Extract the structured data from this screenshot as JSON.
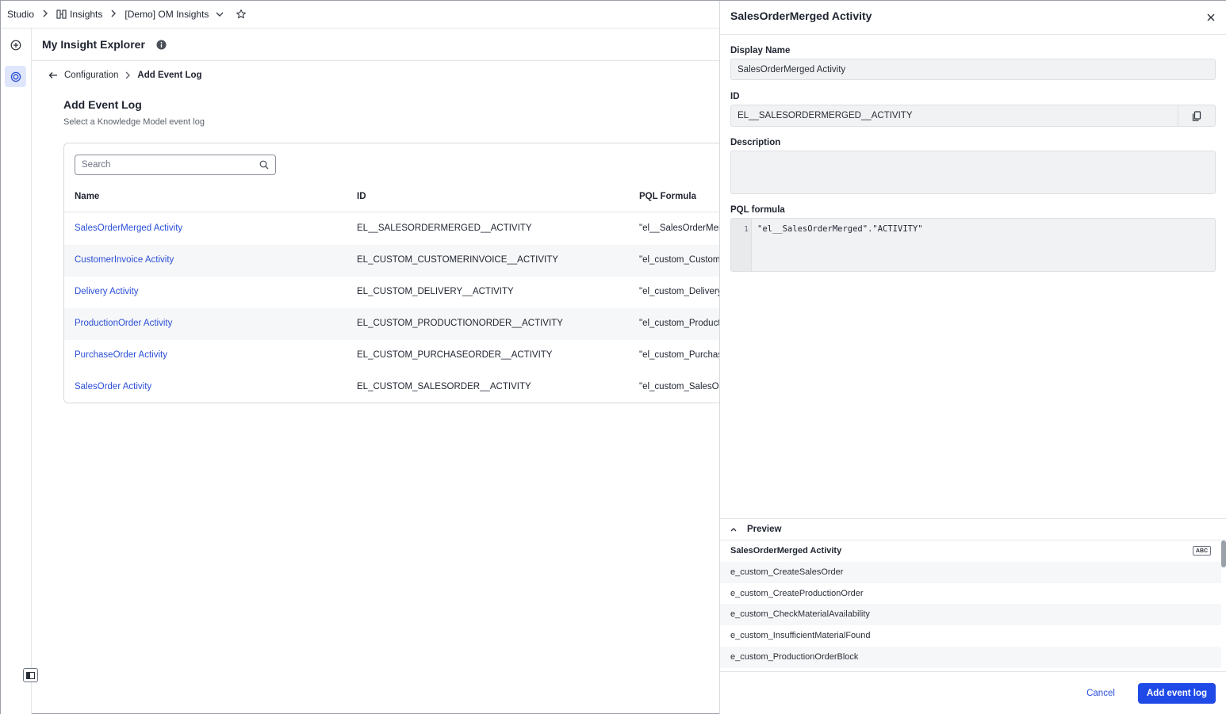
{
  "topbar": {
    "crumbs": [
      "Studio",
      "Insights",
      "[Demo] OM Insights"
    ]
  },
  "header": {
    "title": "My Insight Explorer"
  },
  "breadcrumb": {
    "parent": "Configuration",
    "current": "Add Event Log"
  },
  "section": {
    "title": "Add Event Log",
    "subtitle": "Select a Knowledge Model event log"
  },
  "search": {
    "placeholder": "Search"
  },
  "table": {
    "columns": [
      "Name",
      "ID",
      "PQL Formula"
    ],
    "rows": [
      {
        "name": "SalesOrderMerged Activity",
        "id": "EL__SALESORDERMERGED__ACTIVITY",
        "pql": "\"el__SalesOrderMer"
      },
      {
        "name": "CustomerInvoice Activity",
        "id": "EL_CUSTOM_CUSTOMERINVOICE__ACTIVITY",
        "pql": "\"el_custom_Custom"
      },
      {
        "name": "Delivery Activity",
        "id": "EL_CUSTOM_DELIVERY__ACTIVITY",
        "pql": "\"el_custom_Delivery"
      },
      {
        "name": "ProductionOrder Activity",
        "id": "EL_CUSTOM_PRODUCTIONORDER__ACTIVITY",
        "pql": "\"el_custom_Product"
      },
      {
        "name": "PurchaseOrder Activity",
        "id": "EL_CUSTOM_PURCHASEORDER__ACTIVITY",
        "pql": "\"el_custom_Purchas"
      },
      {
        "name": "SalesOrder Activity",
        "id": "EL_CUSTOM_SALESORDER__ACTIVITY",
        "pql": "\"el_custom_SalesOr"
      }
    ]
  },
  "panel": {
    "title": "SalesOrderMerged Activity",
    "display_name_label": "Display Name",
    "display_name_value": "SalesOrderMerged Activity",
    "id_label": "ID",
    "id_value": "EL__SALESORDERMERGED__ACTIVITY",
    "description_label": "Description",
    "description_value": "",
    "pql_label": "PQL formula",
    "pql_line_number": "1",
    "pql_code": "\"el__SalesOrderMerged\".\"ACTIVITY\"",
    "preview_label": "Preview",
    "preview_column": "SalesOrderMerged Activity",
    "preview_type_badge": "ABC",
    "preview_rows": [
      "e_custom_CreateSalesOrder",
      "e_custom_CreateProductionOrder",
      "e_custom_CheckMaterialAvailability",
      "e_custom_InsufficientMaterialFound",
      "e_custom_ProductionOrderBlock"
    ],
    "cancel_label": "Cancel",
    "add_label": "Add event log"
  },
  "colors": {
    "accent": "#1f4ae8",
    "link": "#2b4fd8",
    "rail_active": "#dfe6fb"
  }
}
